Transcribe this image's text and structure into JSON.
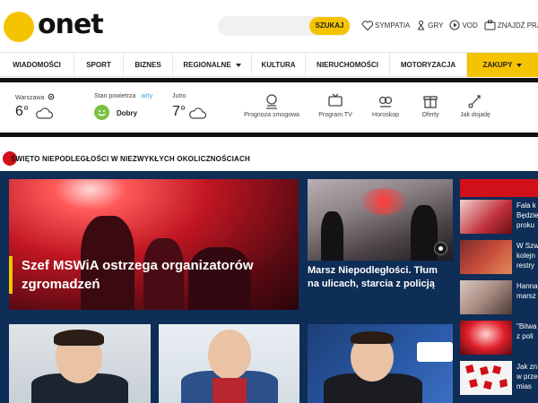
{
  "header": {
    "logo_text": "onet",
    "search_placeholder": "",
    "search_button": "SZUKAJ",
    "links": [
      {
        "icon": "heart-icon",
        "label": "SYMPATIA"
      },
      {
        "icon": "gamepad-icon",
        "label": "GRY"
      },
      {
        "icon": "play-icon",
        "label": "VOD"
      },
      {
        "icon": "briefcase-icon",
        "label": "ZNAJDŹ PRACĘ"
      }
    ]
  },
  "nav": {
    "items": [
      {
        "label": "WIADOMOŚCI"
      },
      {
        "label": "SPORT"
      },
      {
        "label": "BIZNES"
      },
      {
        "label": "REGIONALNE",
        "dropdown": true
      },
      {
        "label": "KULTURA"
      },
      {
        "label": "NIERUCHOMOŚCI"
      },
      {
        "label": "MOTORYZACJA"
      },
      {
        "label": "ZAKUPY",
        "dropdown": true,
        "highlight": true
      }
    ]
  },
  "info": {
    "weather_city": "Warszawa",
    "weather_temp": "6°",
    "air_label": "Stan powietrza",
    "air_provider": "airly",
    "air_status": "Dobry",
    "tomorrow_label": "Jutro",
    "tomorrow_temp": "7°",
    "services": [
      {
        "icon": "smog-icon",
        "label": "Prognoza smogowa"
      },
      {
        "icon": "tv-icon",
        "label": "Program TV"
      },
      {
        "icon": "horoscope-icon",
        "label": "Horoskop"
      },
      {
        "icon": "gift-icon",
        "label": "Oferty"
      },
      {
        "icon": "route-icon",
        "label": "Jak dojadę"
      }
    ]
  },
  "section": {
    "title": "ŚWIĘTO NIEPODLEGŁOŚCI W NIEZWYKŁYCH OKOLICZNOŚCIACH"
  },
  "main": {
    "lead_title": "Szef MSWiA ostrzega organizatorów zgromadzeń",
    "side_title": "Marsz Niepodległości. Tłum na ulicach, starcia z policją",
    "right_news": [
      {
        "text": "Fala k\nBędzie\nproku"
      },
      {
        "text": "W Szw\nkolejn\nrestry"
      },
      {
        "text": "Hanna\nmarsz"
      },
      {
        "text": "\"Bitwa\nz poli"
      },
      {
        "text": "Jak zn\nw prze\nmias"
      }
    ]
  },
  "colors": {
    "accent": "#f5c400",
    "panel": "#0e2d57",
    "brand_red": "#d1101a"
  }
}
